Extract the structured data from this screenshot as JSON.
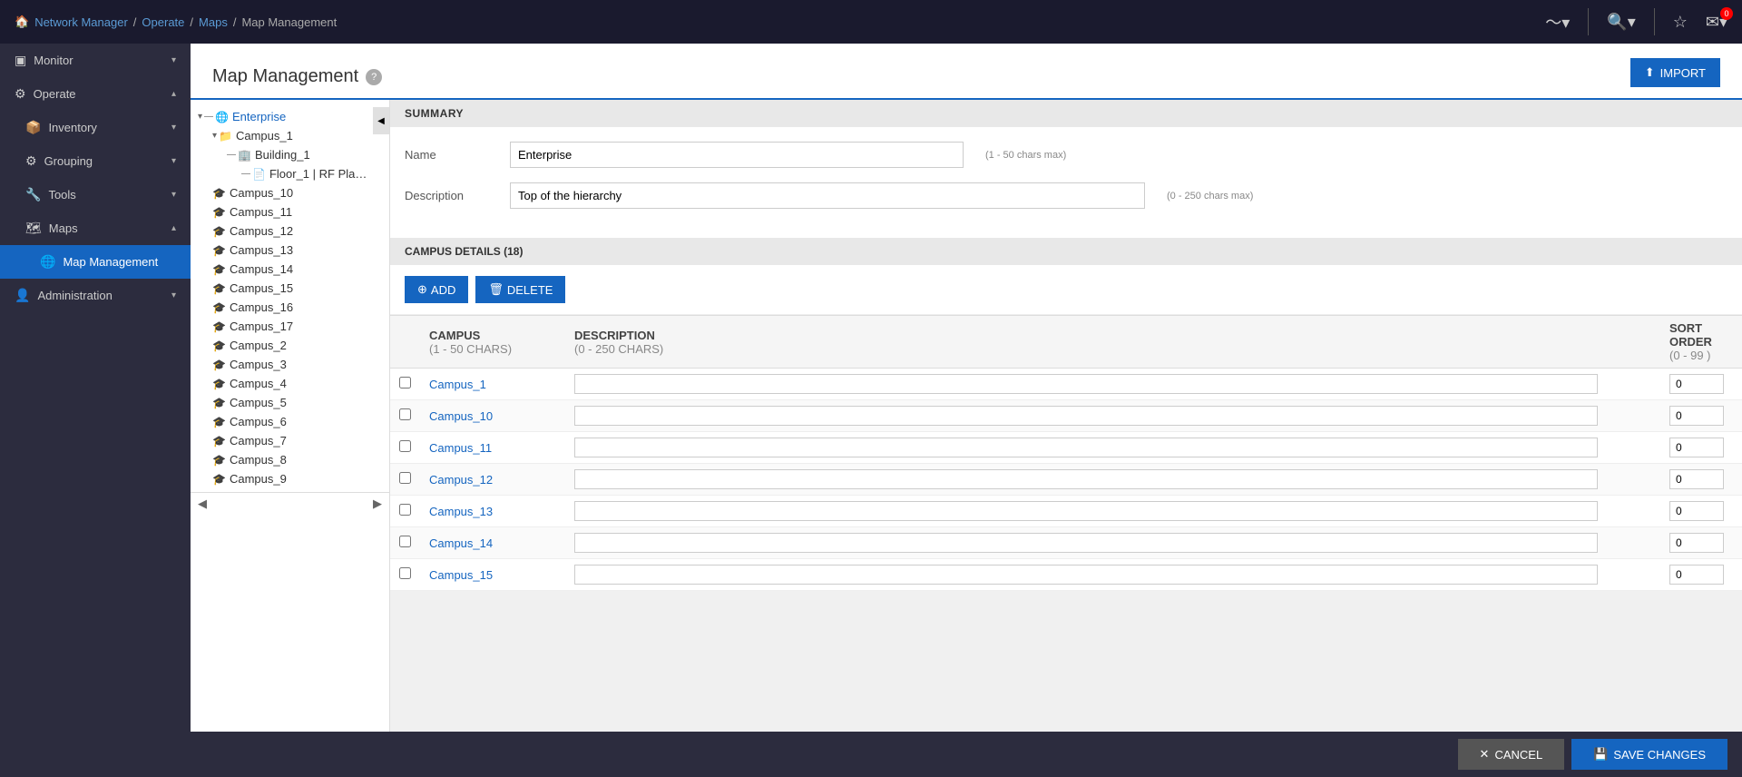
{
  "topnav": {
    "breadcrumbs": [
      {
        "label": "Network Manager",
        "link": true
      },
      {
        "label": "Operate",
        "link": true
      },
      {
        "label": "Maps",
        "link": true
      },
      {
        "label": "Map Management",
        "link": false
      }
    ],
    "icons": {
      "activity": "〜",
      "search": "🔍",
      "star": "☆",
      "mail": "✉"
    },
    "notification_count": "0"
  },
  "sidebar": {
    "items": [
      {
        "label": "Monitor",
        "icon": "▣",
        "has_children": true,
        "expanded": false
      },
      {
        "label": "Operate",
        "icon": "⚙",
        "has_children": true,
        "expanded": true
      },
      {
        "label": "Inventory",
        "icon": "📦",
        "has_children": true,
        "expanded": false,
        "indent": 1
      },
      {
        "label": "Grouping",
        "icon": "⚙",
        "has_children": true,
        "expanded": false,
        "indent": 1
      },
      {
        "label": "Tools",
        "icon": "🔧",
        "has_children": true,
        "expanded": false,
        "indent": 1
      },
      {
        "label": "Maps",
        "icon": "🗺",
        "has_children": true,
        "expanded": true,
        "indent": 1
      },
      {
        "label": "Map Management",
        "icon": "🌐",
        "has_children": false,
        "active": true,
        "indent": 2
      },
      {
        "label": "Administration",
        "icon": "👤",
        "has_children": true,
        "expanded": false
      }
    ]
  },
  "page": {
    "title": "Map Management",
    "import_label": "IMPORT"
  },
  "tree": {
    "nodes": [
      {
        "label": "Enterprise",
        "level": 0,
        "type": "globe",
        "collapsed": false,
        "link": true
      },
      {
        "label": "Campus_1",
        "level": 1,
        "type": "folder"
      },
      {
        "label": "Building_1",
        "level": 2,
        "type": "building"
      },
      {
        "label": "Floor_1 | RF Pla…",
        "level": 3,
        "type": "floor"
      },
      {
        "label": "Campus_10",
        "level": 1,
        "type": "campus"
      },
      {
        "label": "Campus_11",
        "level": 1,
        "type": "campus"
      },
      {
        "label": "Campus_12",
        "level": 1,
        "type": "campus"
      },
      {
        "label": "Campus_13",
        "level": 1,
        "type": "campus"
      },
      {
        "label": "Campus_14",
        "level": 1,
        "type": "campus"
      },
      {
        "label": "Campus_15",
        "level": 1,
        "type": "campus"
      },
      {
        "label": "Campus_16",
        "level": 1,
        "type": "campus"
      },
      {
        "label": "Campus_17",
        "level": 1,
        "type": "campus"
      },
      {
        "label": "Campus_2",
        "level": 1,
        "type": "campus"
      },
      {
        "label": "Campus_3",
        "level": 1,
        "type": "campus"
      },
      {
        "label": "Campus_4",
        "level": 1,
        "type": "campus"
      },
      {
        "label": "Campus_5",
        "level": 1,
        "type": "campus"
      },
      {
        "label": "Campus_6",
        "level": 1,
        "type": "campus"
      },
      {
        "label": "Campus_7",
        "level": 1,
        "type": "campus"
      },
      {
        "label": "Campus_8",
        "level": 1,
        "type": "campus"
      },
      {
        "label": "Campus_9",
        "level": 1,
        "type": "campus"
      }
    ]
  },
  "summary": {
    "section_label": "SUMMARY",
    "name_label": "Name",
    "name_value": "Enterprise",
    "name_hint": "(1 - 50 chars max)",
    "desc_label": "Description",
    "desc_value": "Top of the hierarchy",
    "desc_hint": "(0 - 250 chars max)"
  },
  "campus_details": {
    "section_label": "CAMPUS DETAILS (18)",
    "add_label": "ADD",
    "delete_label": "DELETE",
    "columns": {
      "campus": "CAMPUS",
      "campus_sub": "(1 - 50 CHARS)",
      "description": "DESCRIPTION",
      "description_sub": "(0 - 250 CHARS)",
      "sort_order": "SORT ORDER",
      "sort_order_sub": "(0 - 99 )"
    },
    "rows": [
      {
        "name": "Campus_1",
        "description": "",
        "sort_order": "0"
      },
      {
        "name": "Campus_10",
        "description": "",
        "sort_order": "0"
      },
      {
        "name": "Campus_11",
        "description": "",
        "sort_order": "0"
      },
      {
        "name": "Campus_12",
        "description": "",
        "sort_order": "0"
      },
      {
        "name": "Campus_13",
        "description": "",
        "sort_order": "0"
      },
      {
        "name": "Campus_14",
        "description": "",
        "sort_order": "0"
      },
      {
        "name": "Campus_15",
        "description": "",
        "sort_order": "0"
      }
    ]
  },
  "footer": {
    "cancel_label": "CANCEL",
    "save_label": "SAVE CHANGES"
  }
}
